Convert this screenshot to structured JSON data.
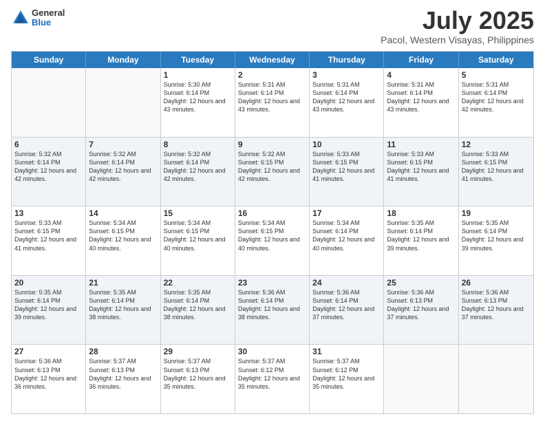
{
  "header": {
    "logo_general": "General",
    "logo_blue": "Blue",
    "title": "July 2025",
    "subtitle": "Pacol, Western Visayas, Philippines"
  },
  "calendar": {
    "days": [
      "Sunday",
      "Monday",
      "Tuesday",
      "Wednesday",
      "Thursday",
      "Friday",
      "Saturday"
    ],
    "weeks": [
      [
        {
          "day": "",
          "info": ""
        },
        {
          "day": "",
          "info": ""
        },
        {
          "day": "1",
          "info": "Sunrise: 5:30 AM\nSunset: 6:14 PM\nDaylight: 12 hours and 43 minutes."
        },
        {
          "day": "2",
          "info": "Sunrise: 5:31 AM\nSunset: 6:14 PM\nDaylight: 12 hours and 43 minutes."
        },
        {
          "day": "3",
          "info": "Sunrise: 5:31 AM\nSunset: 6:14 PM\nDaylight: 12 hours and 43 minutes."
        },
        {
          "day": "4",
          "info": "Sunrise: 5:31 AM\nSunset: 6:14 PM\nDaylight: 12 hours and 43 minutes."
        },
        {
          "day": "5",
          "info": "Sunrise: 5:31 AM\nSunset: 6:14 PM\nDaylight: 12 hours and 42 minutes."
        }
      ],
      [
        {
          "day": "6",
          "info": "Sunrise: 5:32 AM\nSunset: 6:14 PM\nDaylight: 12 hours and 42 minutes."
        },
        {
          "day": "7",
          "info": "Sunrise: 5:32 AM\nSunset: 6:14 PM\nDaylight: 12 hours and 42 minutes."
        },
        {
          "day": "8",
          "info": "Sunrise: 5:32 AM\nSunset: 6:14 PM\nDaylight: 12 hours and 42 minutes."
        },
        {
          "day": "9",
          "info": "Sunrise: 5:32 AM\nSunset: 6:15 PM\nDaylight: 12 hours and 42 minutes."
        },
        {
          "day": "10",
          "info": "Sunrise: 5:33 AM\nSunset: 6:15 PM\nDaylight: 12 hours and 41 minutes."
        },
        {
          "day": "11",
          "info": "Sunrise: 5:33 AM\nSunset: 6:15 PM\nDaylight: 12 hours and 41 minutes."
        },
        {
          "day": "12",
          "info": "Sunrise: 5:33 AM\nSunset: 6:15 PM\nDaylight: 12 hours and 41 minutes."
        }
      ],
      [
        {
          "day": "13",
          "info": "Sunrise: 5:33 AM\nSunset: 6:15 PM\nDaylight: 12 hours and 41 minutes."
        },
        {
          "day": "14",
          "info": "Sunrise: 5:34 AM\nSunset: 6:15 PM\nDaylight: 12 hours and 40 minutes."
        },
        {
          "day": "15",
          "info": "Sunrise: 5:34 AM\nSunset: 6:15 PM\nDaylight: 12 hours and 40 minutes."
        },
        {
          "day": "16",
          "info": "Sunrise: 5:34 AM\nSunset: 6:15 PM\nDaylight: 12 hours and 40 minutes."
        },
        {
          "day": "17",
          "info": "Sunrise: 5:34 AM\nSunset: 6:14 PM\nDaylight: 12 hours and 40 minutes."
        },
        {
          "day": "18",
          "info": "Sunrise: 5:35 AM\nSunset: 6:14 PM\nDaylight: 12 hours and 39 minutes."
        },
        {
          "day": "19",
          "info": "Sunrise: 5:35 AM\nSunset: 6:14 PM\nDaylight: 12 hours and 39 minutes."
        }
      ],
      [
        {
          "day": "20",
          "info": "Sunrise: 5:35 AM\nSunset: 6:14 PM\nDaylight: 12 hours and 39 minutes."
        },
        {
          "day": "21",
          "info": "Sunrise: 5:35 AM\nSunset: 6:14 PM\nDaylight: 12 hours and 38 minutes."
        },
        {
          "day": "22",
          "info": "Sunrise: 5:35 AM\nSunset: 6:14 PM\nDaylight: 12 hours and 38 minutes."
        },
        {
          "day": "23",
          "info": "Sunrise: 5:36 AM\nSunset: 6:14 PM\nDaylight: 12 hours and 38 minutes."
        },
        {
          "day": "24",
          "info": "Sunrise: 5:36 AM\nSunset: 6:14 PM\nDaylight: 12 hours and 37 minutes."
        },
        {
          "day": "25",
          "info": "Sunrise: 5:36 AM\nSunset: 6:13 PM\nDaylight: 12 hours and 37 minutes."
        },
        {
          "day": "26",
          "info": "Sunrise: 5:36 AM\nSunset: 6:13 PM\nDaylight: 12 hours and 37 minutes."
        }
      ],
      [
        {
          "day": "27",
          "info": "Sunrise: 5:36 AM\nSunset: 6:13 PM\nDaylight: 12 hours and 36 minutes."
        },
        {
          "day": "28",
          "info": "Sunrise: 5:37 AM\nSunset: 6:13 PM\nDaylight: 12 hours and 36 minutes."
        },
        {
          "day": "29",
          "info": "Sunrise: 5:37 AM\nSunset: 6:13 PM\nDaylight: 12 hours and 35 minutes."
        },
        {
          "day": "30",
          "info": "Sunrise: 5:37 AM\nSunset: 6:12 PM\nDaylight: 12 hours and 35 minutes."
        },
        {
          "day": "31",
          "info": "Sunrise: 5:37 AM\nSunset: 6:12 PM\nDaylight: 12 hours and 35 minutes."
        },
        {
          "day": "",
          "info": ""
        },
        {
          "day": "",
          "info": ""
        }
      ]
    ]
  }
}
